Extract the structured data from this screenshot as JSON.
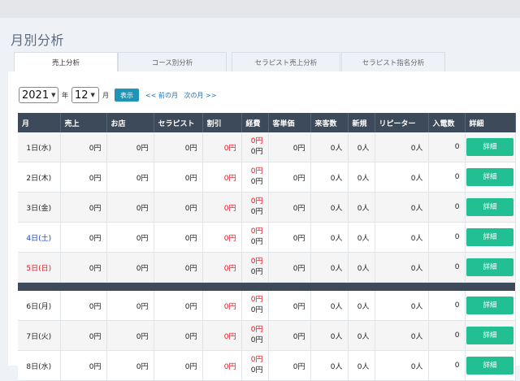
{
  "page_title": "月別分析",
  "tabs": [
    {
      "label": "売上分析",
      "active": true
    },
    {
      "label": "コース別分析",
      "active": false
    },
    {
      "label": "セラピスト売上分析",
      "active": false
    },
    {
      "label": "セラピスト指名分析",
      "active": false
    }
  ],
  "controls": {
    "year": "2021",
    "year_unit": "年",
    "month": "12",
    "month_unit": "月",
    "show_label": "表示",
    "prev_label": "<< 前の月",
    "next_label": "次の月 >>"
  },
  "table": {
    "headers": [
      "月",
      "売上",
      "お店",
      "セラピスト",
      "割引",
      "経費",
      "客単価",
      "来客数",
      "新規",
      "リピーター",
      "入電数",
      "詳細"
    ],
    "rows": [
      {
        "day": "1日(水)",
        "day_color": "",
        "sales": "0円",
        "shop": "0円",
        "therapist": "0円",
        "discount": "0円",
        "expense1": "0円",
        "expense2": "0円",
        "unit_price": "0円",
        "visitors": "0人",
        "new": "0人",
        "repeat": "0人",
        "calls": "0",
        "detail": "詳細"
      },
      {
        "day": "2日(木)",
        "day_color": "",
        "sales": "0円",
        "shop": "0円",
        "therapist": "0円",
        "discount": "0円",
        "expense1": "0円",
        "expense2": "0円",
        "unit_price": "0円",
        "visitors": "0人",
        "new": "0人",
        "repeat": "0人",
        "calls": "0",
        "detail": "詳細"
      },
      {
        "day": "3日(金)",
        "day_color": "",
        "sales": "0円",
        "shop": "0円",
        "therapist": "0円",
        "discount": "0円",
        "expense1": "0円",
        "expense2": "0円",
        "unit_price": "0円",
        "visitors": "0人",
        "new": "0人",
        "repeat": "0人",
        "calls": "0",
        "detail": "詳細"
      },
      {
        "day": "4日(土)",
        "day_color": "blue",
        "sales": "0円",
        "shop": "0円",
        "therapist": "0円",
        "discount": "0円",
        "expense1": "0円",
        "expense2": "0円",
        "unit_price": "0円",
        "visitors": "0人",
        "new": "0人",
        "repeat": "0人",
        "calls": "0",
        "detail": "詳細"
      },
      {
        "day": "5日(日)",
        "day_color": "red",
        "sales": "0円",
        "shop": "0円",
        "therapist": "0円",
        "discount": "0円",
        "expense1": "0円",
        "expense2": "0円",
        "unit_price": "0円",
        "visitors": "0人",
        "new": "0人",
        "repeat": "0人",
        "calls": "0",
        "detail": "詳細"
      },
      {
        "separator": true
      },
      {
        "day": "6日(月)",
        "day_color": "",
        "sales": "0円",
        "shop": "0円",
        "therapist": "0円",
        "discount": "0円",
        "expense1": "0円",
        "expense2": "0円",
        "unit_price": "0円",
        "visitors": "0人",
        "new": "0人",
        "repeat": "0人",
        "calls": "0",
        "detail": "詳細"
      },
      {
        "day": "7日(火)",
        "day_color": "",
        "sales": "0円",
        "shop": "0円",
        "therapist": "0円",
        "discount": "0円",
        "expense1": "0円",
        "expense2": "0円",
        "unit_price": "0円",
        "visitors": "0人",
        "new": "0人",
        "repeat": "0人",
        "calls": "0",
        "detail": "詳細"
      },
      {
        "day": "8日(水)",
        "day_color": "",
        "sales": "0円",
        "shop": "0円",
        "therapist": "0円",
        "discount": "0円",
        "expense1": "0円",
        "expense2": "0円",
        "unit_price": "0円",
        "visitors": "0人",
        "new": "0人",
        "repeat": "0人",
        "calls": "0",
        "detail": "詳細"
      }
    ]
  },
  "colors": {
    "header_bg": "#3c4a5a",
    "detail_button": "#21bf92",
    "show_button": "#1f95b6",
    "negative_red": "#e8141e",
    "saturday_blue": "#1846c8"
  }
}
